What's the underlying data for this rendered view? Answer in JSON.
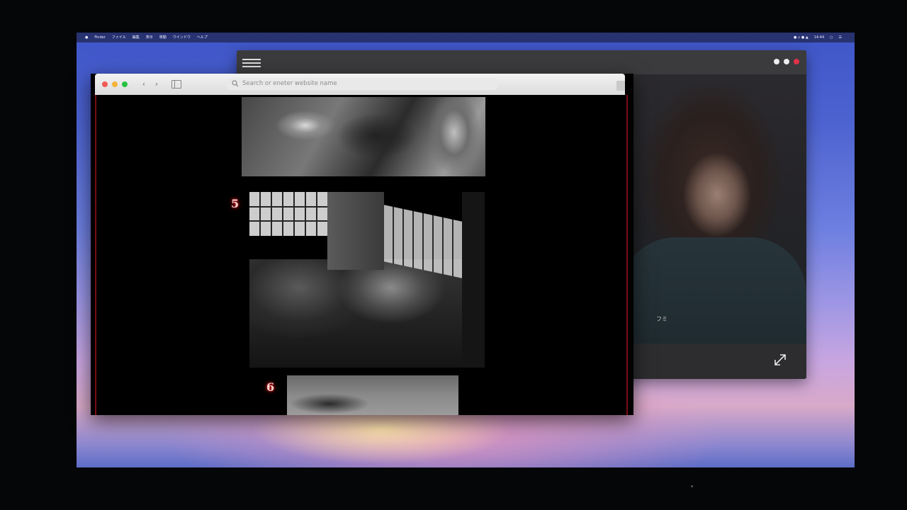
{
  "menubar": {
    "apple": "",
    "items": [
      "Finder",
      "ファイル",
      "編集",
      "表示",
      "移動",
      "ウインドウ",
      "ヘルプ"
    ],
    "clock": "14:44"
  },
  "browser": {
    "address_placeholder": "Search or eneter website name",
    "traffic_colors": [
      "#f25a55",
      "#f6b33a",
      "#27c23f"
    ]
  },
  "page": {
    "photo_numbers": [
      "5",
      "6"
    ]
  },
  "video_window": {
    "subtitle": "フミ"
  }
}
